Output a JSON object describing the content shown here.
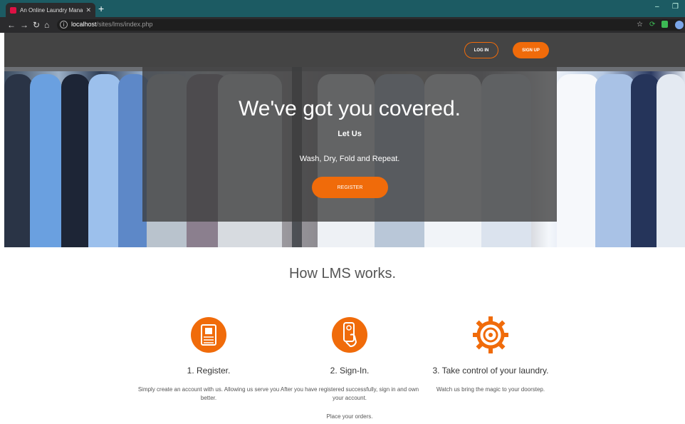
{
  "browser": {
    "tab_title": "An Online Laundry Management",
    "new_tab": "+",
    "url_host": "localhost",
    "url_path": "/sites/lms/index.php"
  },
  "header": {
    "login_label": "LOG IN",
    "signup_label": "SIGN UP"
  },
  "hero": {
    "title": "We've got you covered.",
    "subtitle": "Let Us",
    "tagline": "Wash, Dry, Fold and Repeat.",
    "register_label": "REGISTER"
  },
  "how": {
    "title": "How LMS works.",
    "steps": [
      {
        "icon": "id-card-icon",
        "heading": "1. Register.",
        "desc": "Simply create an account with us. Allowing us serve you better."
      },
      {
        "icon": "phone-touch-icon",
        "heading": "2. Sign-In.",
        "desc": "After you have registered successfully, sign in and own your account.",
        "extra": "Place your orders."
      },
      {
        "icon": "gear-target-icon",
        "heading": "3. Take control of your laundry.",
        "desc": "Watch us bring the magic to your doorstep."
      }
    ]
  },
  "colors": {
    "accent": "#f06b0a",
    "header_bg": "#444444",
    "tab_bar": "#1c5b63"
  }
}
